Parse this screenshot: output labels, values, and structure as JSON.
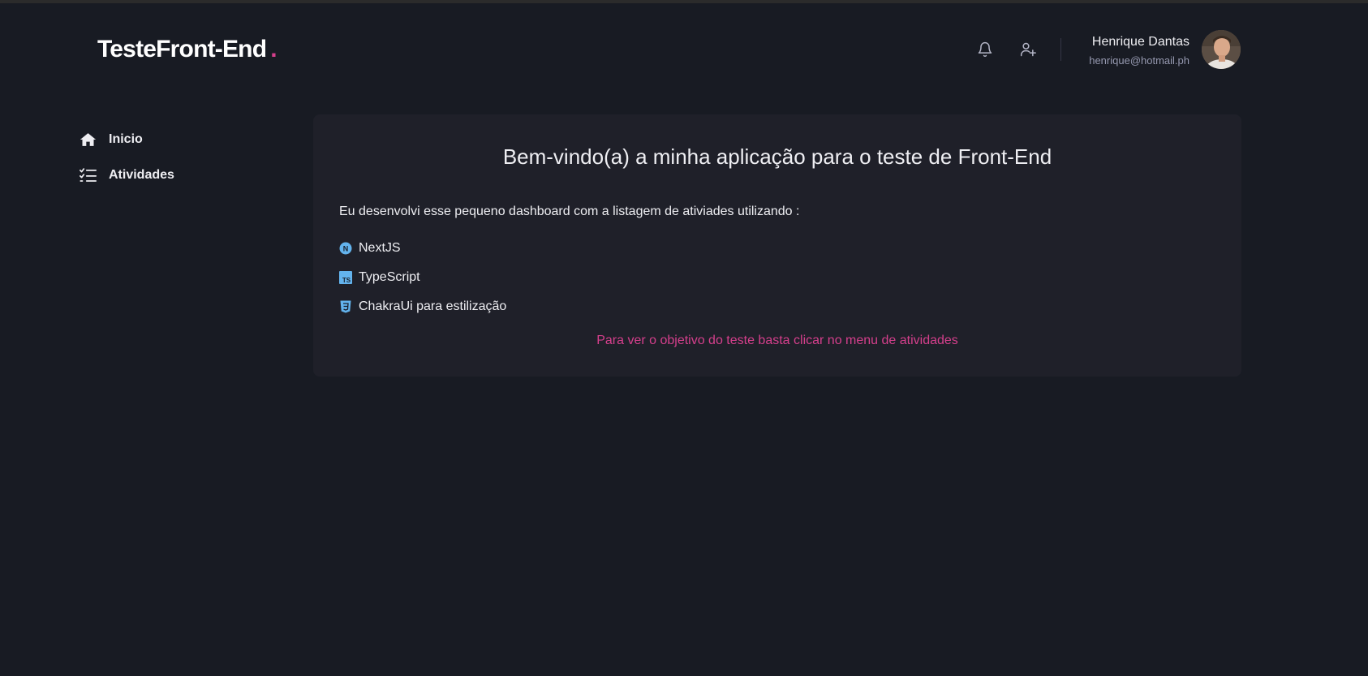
{
  "header": {
    "logo_text": "TesteFront-End",
    "logo_dot": ".",
    "user": {
      "name": "Henrique Dantas",
      "email": "henrique@hotmail.ph"
    }
  },
  "sidebar": {
    "items": [
      {
        "label": "Inicio",
        "icon": "home-icon"
      },
      {
        "label": "Atividades",
        "icon": "list-check-icon"
      }
    ]
  },
  "main": {
    "title": "Bem-vindo(a) a minha aplicação para o teste de Front-End",
    "intro": "Eu desenvolvi esse pequeno dashboard com a listagem de ativiades utilizando :",
    "technologies": [
      {
        "label": "NextJS",
        "icon": "nextjs-icon"
      },
      {
        "label": "TypeScript",
        "icon": "typescript-icon"
      },
      {
        "label": "ChakraUi para estilização",
        "icon": "css3-icon"
      }
    ],
    "cta": "Para ver o objetivo do teste basta clicar no menu de atividades"
  },
  "colors": {
    "background": "#181b23",
    "card": "#1f2029",
    "accent": "#d53f8c",
    "icon_blue": "#63b3ed"
  }
}
